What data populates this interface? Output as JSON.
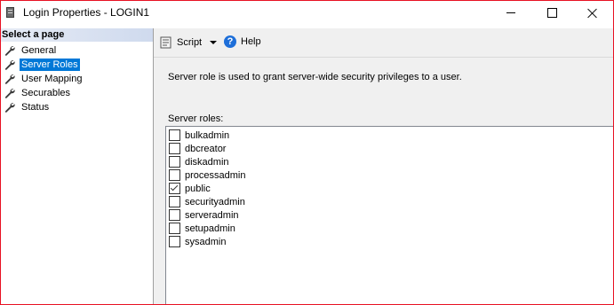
{
  "window": {
    "title": "Login Properties - LOGIN1"
  },
  "sidebar": {
    "header": "Select a page",
    "items": [
      {
        "label": "General",
        "selected": false
      },
      {
        "label": "Server Roles",
        "selected": true
      },
      {
        "label": "User Mapping",
        "selected": false
      },
      {
        "label": "Securables",
        "selected": false
      },
      {
        "label": "Status",
        "selected": false
      }
    ]
  },
  "toolbar": {
    "script_label": "Script",
    "help_label": "Help"
  },
  "main": {
    "description": "Server role is used to grant server-wide security privileges to a user.",
    "roles_caption": "Server roles:",
    "roles": [
      {
        "label": "bulkadmin",
        "checked": false
      },
      {
        "label": "dbcreator",
        "checked": false
      },
      {
        "label": "diskadmin",
        "checked": false
      },
      {
        "label": "processadmin",
        "checked": false
      },
      {
        "label": "public",
        "checked": true
      },
      {
        "label": "securityadmin",
        "checked": false
      },
      {
        "label": "serveradmin",
        "checked": false
      },
      {
        "label": "setupadmin",
        "checked": false
      },
      {
        "label": "sysadmin",
        "checked": false
      }
    ]
  },
  "colors": {
    "selection": "#0078d7",
    "window_border": "#e81123",
    "panel_background": "#f0f0f0"
  }
}
